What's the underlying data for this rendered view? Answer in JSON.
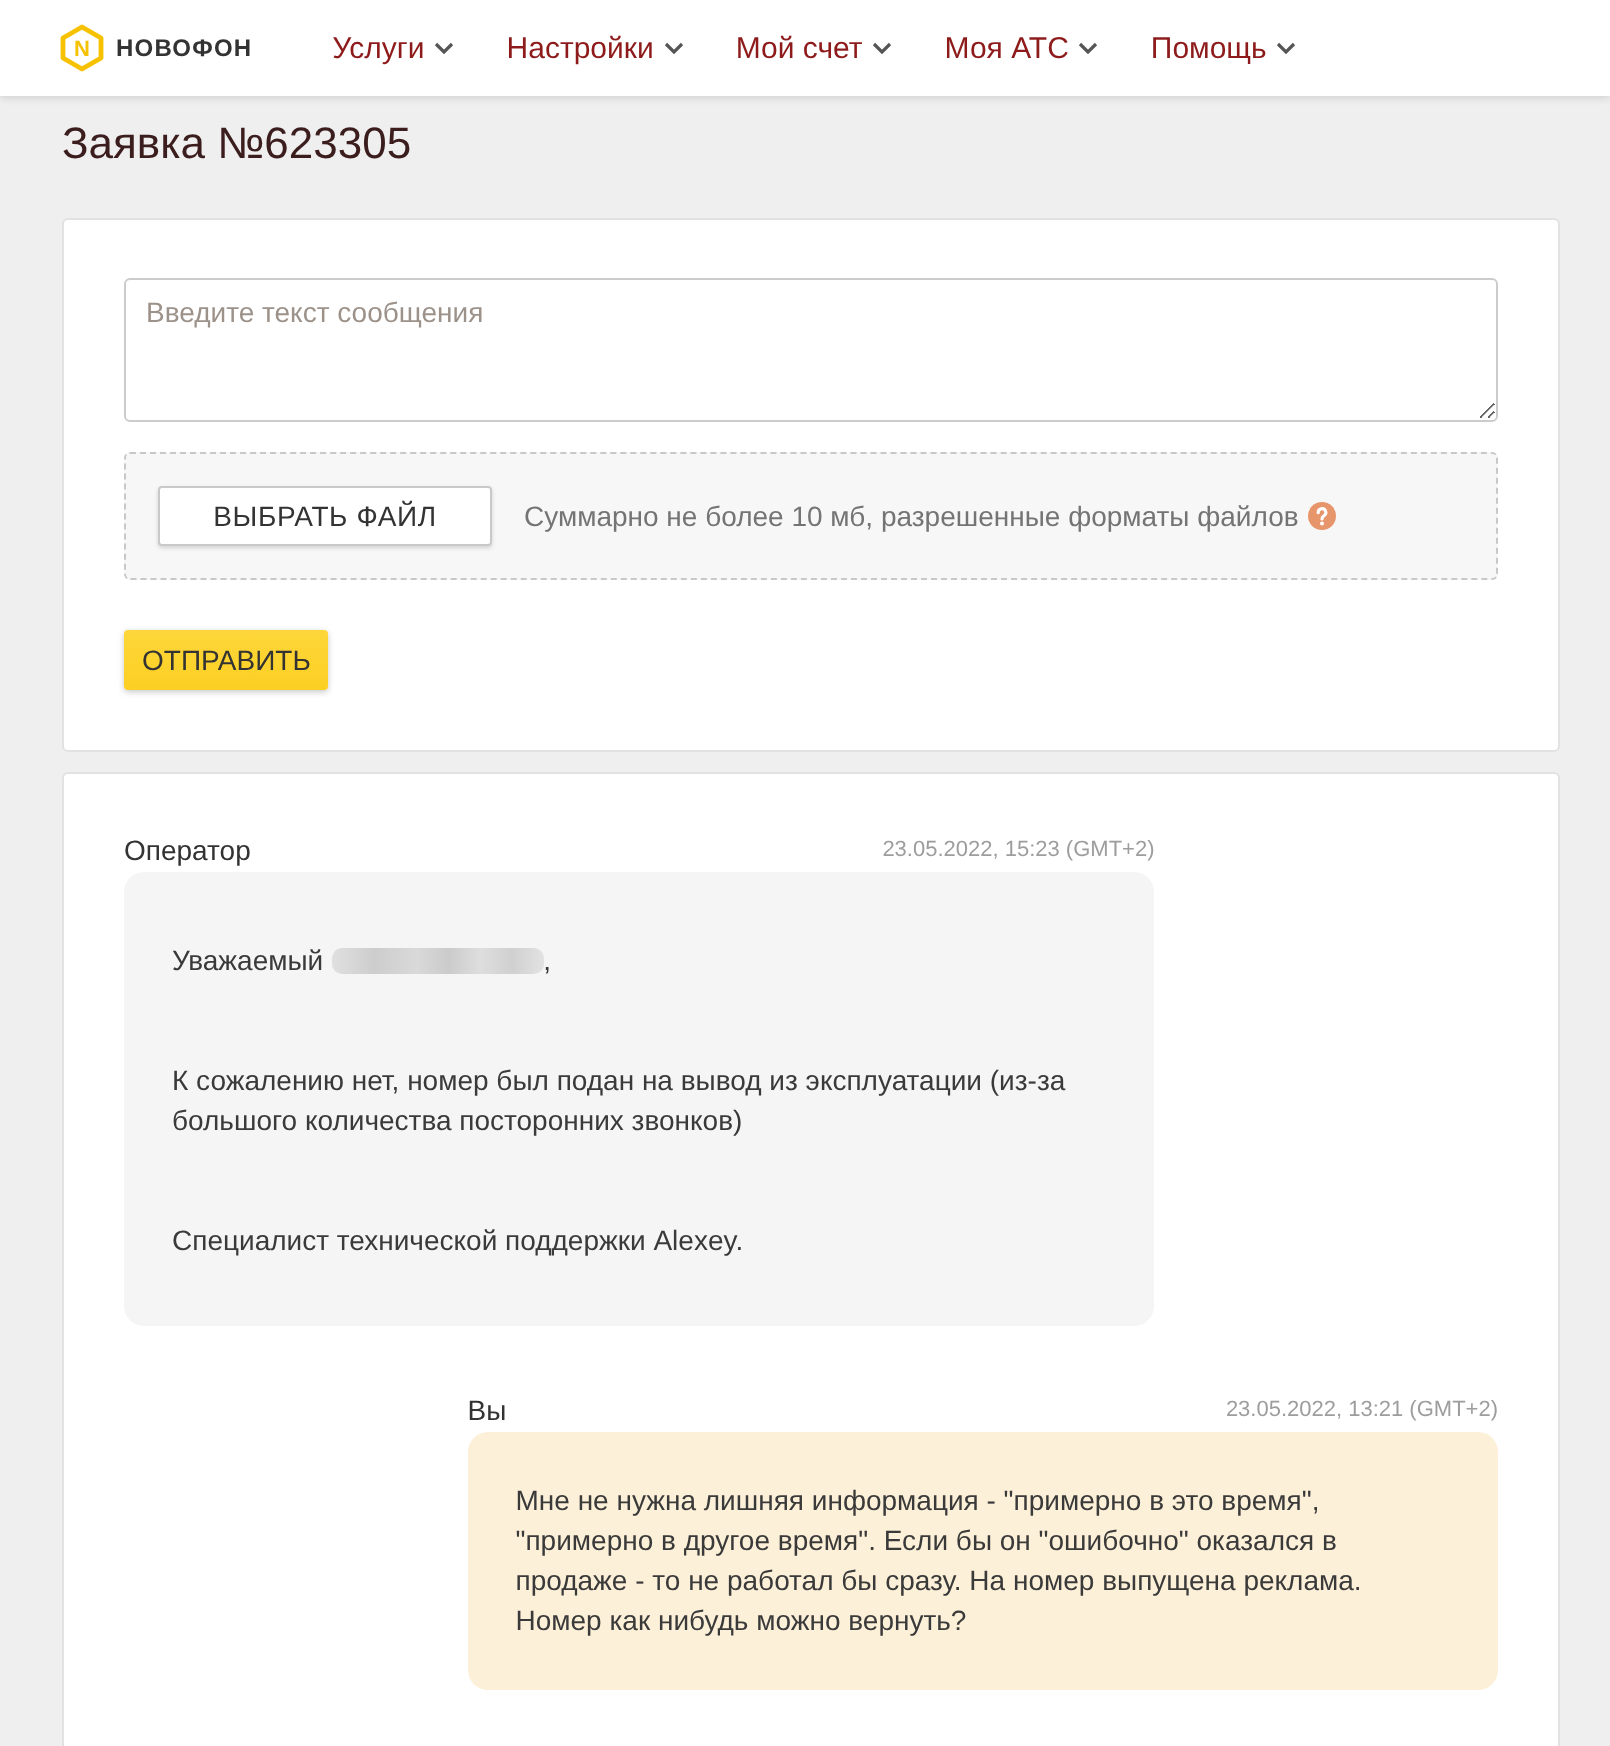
{
  "header": {
    "logo": {
      "mark": "N",
      "name": "НОВОФОН"
    },
    "nav": [
      {
        "label": "Услуги",
        "dropdown": true
      },
      {
        "label": "Настройки",
        "dropdown": true
      },
      {
        "label": "Мой счет",
        "dropdown": true
      },
      {
        "label": "Моя АТС",
        "dropdown": true
      },
      {
        "label": "Помощь",
        "dropdown": true
      }
    ]
  },
  "title": "Заявка №623305",
  "reply_form": {
    "message": {
      "placeholder": "Введите текст сообщения"
    },
    "file_button": "ВЫБРАТЬ ФАЙЛ",
    "file_hint": "Суммарно не более 10 мб, разрешенные форматы файлов",
    "send_button": "ОТПРАВИТЬ"
  },
  "messages": [
    {
      "kind": "incoming",
      "author": "Оператор",
      "time": "23.05.2022, 15:23 (GMT+2)",
      "paragraphs": [
        {
          "text": "Уважаемый",
          "redacted_name": true,
          "suffix": ","
        },
        {
          "text": "К сожалению нет, номер был подан на вывод из эксплуатации (из-за большого количества посторонних звонков)"
        },
        {
          "text": "Специалист технической поддержки Alexey."
        }
      ]
    },
    {
      "kind": "outgoing",
      "author": "Вы",
      "time": "23.05.2022, 13:21 (GMT+2)",
      "paragraphs": [
        {
          "text": "Мне не нужна лишняя информация - \"примерно в это время\", \"примерно в другое время\". Если бы он \"ошибочно\" оказался в продаже - то не работал бы сразу. На номер выпущена реклама. Номер как нибудь можно вернуть?"
        }
      ]
    }
  ]
}
